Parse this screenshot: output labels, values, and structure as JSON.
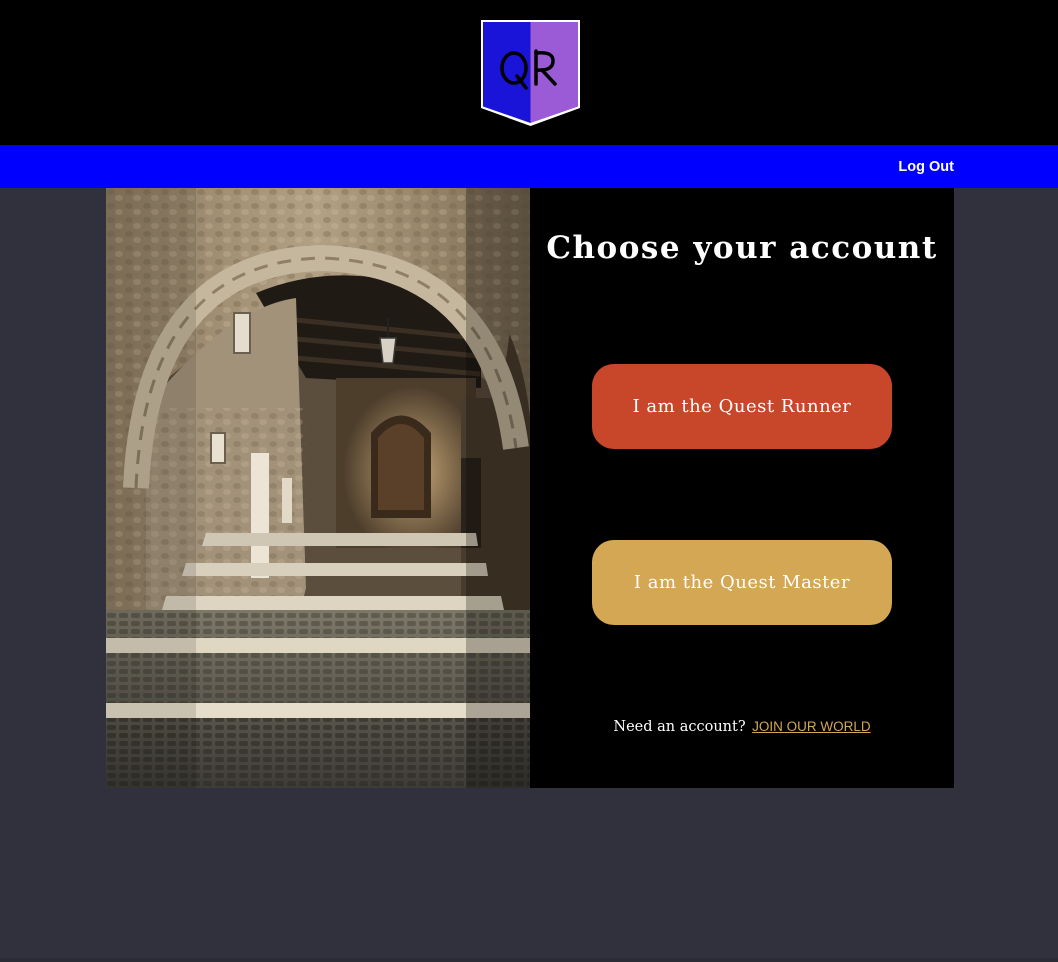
{
  "brand": {
    "logo_text": "QR",
    "colors": {
      "left": "#1a14d8",
      "right": "#9b5bd6"
    }
  },
  "nav": {
    "logout_label": "Log Out",
    "background": "#0000ff"
  },
  "hero": {
    "image": "stone-archway-photo-icon"
  },
  "account_select": {
    "title": "Choose your account",
    "runner_label": "I am the Quest Runner",
    "master_label": "I am the Quest Master",
    "signup_prompt": "Need an account?",
    "signup_link": "JOIN OUR WORLD"
  },
  "theme": {
    "page_bg": "#30313d",
    "runner_color": "#c8472b",
    "master_color": "#d3a754"
  }
}
